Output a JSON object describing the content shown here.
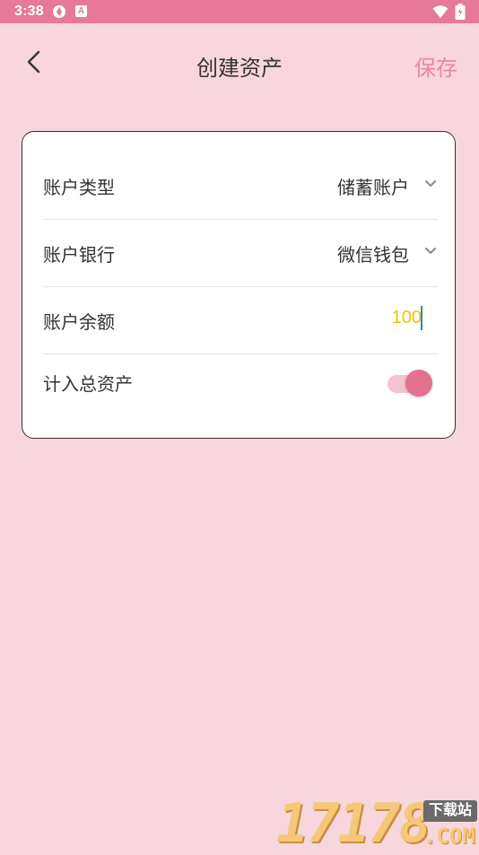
{
  "status_bar": {
    "time": "3:38",
    "app_icon_letter": "A",
    "background_color": "#e6799a"
  },
  "header": {
    "back_icon": "chevron-left-icon",
    "title": "创建资产",
    "save_label": "保存",
    "save_color": "#ea86a3"
  },
  "form": {
    "account_type": {
      "label": "账户类型",
      "value": "储蓄账户",
      "icon": "chevron-down-icon"
    },
    "account_bank": {
      "label": "账户银行",
      "value": "微信钱包",
      "icon": "chevron-down-icon"
    },
    "account_balance": {
      "label": "账户余额",
      "value": "100",
      "value_color": "#f2c500"
    },
    "include_total": {
      "label": "计入总资产",
      "enabled": true,
      "thumb_color": "#e2718f"
    }
  },
  "watermark": {
    "digits": "17178",
    "badge": "下载站",
    "domain": ".COM"
  },
  "colors": {
    "page_background": "#f7d6dd",
    "card_border": "#3a2a2e"
  }
}
